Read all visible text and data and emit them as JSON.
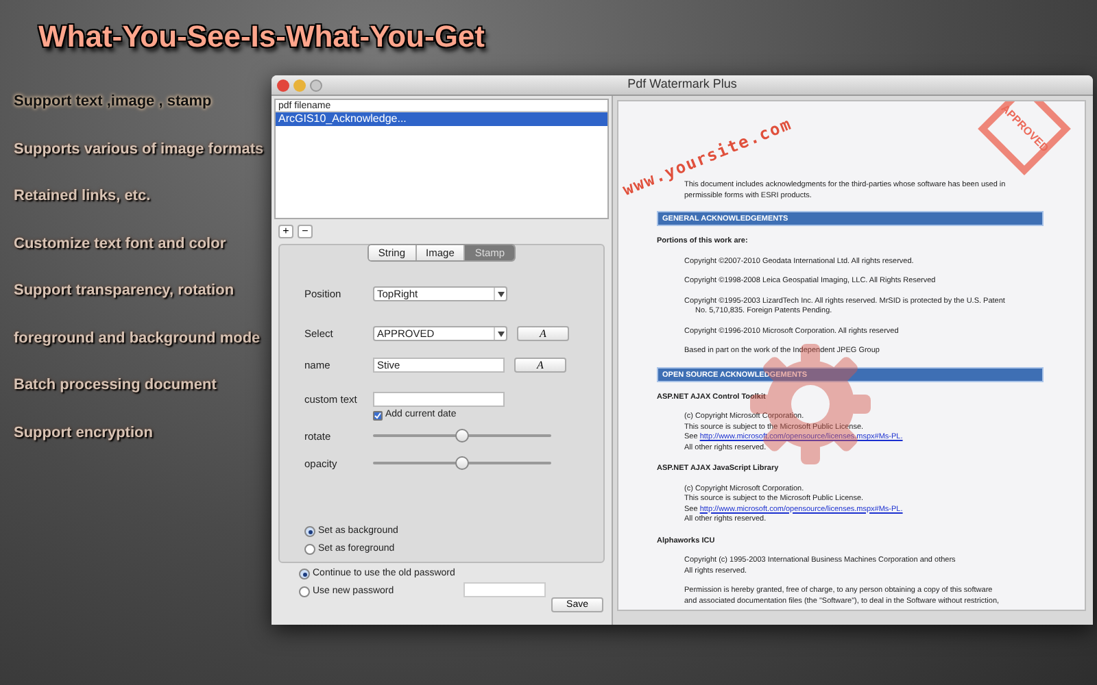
{
  "headline": "What-You-See-Is-What-You-Get",
  "features": [
    {
      "text": "Support text ,image , stamp",
      "selected": true
    },
    {
      "text": "Supports various of  image formats",
      "selected": false
    },
    {
      "text": "Retained links, etc.",
      "selected": false
    },
    {
      "text": "Customize text font and color",
      "selected": false
    },
    {
      "text": "Support transparency, rotation",
      "selected": false
    },
    {
      "text": "foreground and background mode",
      "selected": false
    },
    {
      "text": "Batch processing document",
      "selected": false
    },
    {
      "text": "Support encryption",
      "selected": false
    }
  ],
  "window": {
    "title": "Pdf Watermark Plus"
  },
  "file_list": {
    "column": "pdf filename",
    "rows": [
      {
        "name": "ArcGIS10_Acknowledge...",
        "selected": true
      }
    ]
  },
  "list_buttons": [
    "+",
    "−"
  ],
  "tabs": [
    {
      "label": "String",
      "selected": false
    },
    {
      "label": "Image",
      "selected": false
    },
    {
      "label": "Stamp",
      "selected": true
    }
  ],
  "form": {
    "position": {
      "label": "Position",
      "value": "TopRight"
    },
    "select": {
      "label": "Select",
      "value": "APPROVED",
      "button": "A"
    },
    "name": {
      "label": "name",
      "value": "Stive",
      "button": "A"
    },
    "custom_text": {
      "label": "custom text"
    },
    "add_date": {
      "label": "Add current date",
      "checked": true
    },
    "sliders": [
      {
        "label": "rotate",
        "level": 0.5
      },
      {
        "label": "opacity",
        "level": 0.5
      }
    ]
  },
  "layer_mode": [
    {
      "label": "Set as background",
      "selected": true
    },
    {
      "label": "Set as foreground",
      "selected": false
    }
  ],
  "password": [
    {
      "label": "Continue to use the old password",
      "selected": true
    },
    {
      "label": "Use new password",
      "selected": false
    }
  ],
  "save": "Save",
  "preview": {
    "watermark_text": "www.yoursite.com",
    "stamp_text": "APPROVED",
    "intro": "This document includes acknowledgments for the third-parties whose software has been used in permissible forms with ESRI products.",
    "blocks": [
      {
        "kind": "bar",
        "text": "GENERAL ACKNOWLEDGEMENTS"
      },
      {
        "kind": "bold",
        "text": "Portions of this work are:"
      },
      {
        "kind": "para",
        "lines": [
          {
            "text": "Copyright ©2007-2010 Geodata International Ltd. All rights reserved."
          }
        ]
      },
      {
        "kind": "para",
        "lines": [
          {
            "text": "Copyright ©1998-2008 Leica Geospatial Imaging, LLC. All Rights Reserved"
          }
        ]
      },
      {
        "kind": "para",
        "lines": [
          {
            "text": "Copyright ©1995-2003 LizardTech Inc.  All rights reserved.  MrSID is protected by the U.S. Patent"
          },
          {
            "text": "No. 5,710,835. Foreign Patents Pending."
          }
        ]
      },
      {
        "kind": "para",
        "lines": [
          {
            "text": "Copyright ©1996-2010 Microsoft Corporation. All rights reserved"
          }
        ]
      },
      {
        "kind": "para",
        "lines": [
          {
            "text": "Based in part on the work of the Independent JPEG Group"
          }
        ]
      },
      {
        "kind": "bar",
        "text": "OPEN SOURCE ACKNOWLEDGEMENTS"
      },
      {
        "kind": "bold",
        "text": "ASP.NET AJAX Control Toolkit"
      },
      {
        "kind": "para",
        "lines": [
          {
            "text": "(c) Copyright Microsoft Corporation."
          },
          {
            "text": "This source is subject to the Microsoft Public License."
          },
          {
            "text": "See ",
            "link": "http://www.microsoft.com/opensource/licenses.mspx#Ms-PL."
          },
          {
            "text": "All other rights reserved."
          }
        ]
      },
      {
        "kind": "bold",
        "text": "ASP.NET AJAX JavaScript Library"
      },
      {
        "kind": "para",
        "lines": [
          {
            "text": "(c) Copyright Microsoft Corporation."
          },
          {
            "text": "This source is subject to the Microsoft Public License."
          },
          {
            "text": "See ",
            "link": "http://www.microsoft.com/opensource/licenses.mspx#Ms-PL."
          },
          {
            "text": "All other rights reserved."
          }
        ]
      },
      {
        "kind": "bold",
        "text": "Alphaworks ICU"
      },
      {
        "kind": "para",
        "lines": [
          {
            "text": "Copyright (c) 1995-2003 International Business Machines Corporation and others"
          },
          {
            "text": "All rights reserved."
          }
        ]
      },
      {
        "kind": "para",
        "lines": [
          {
            "text": "Permission is hereby granted, free of charge, to any person obtaining a copy of this software"
          },
          {
            "text": "and associated documentation files (the \"Software\"), to deal in the Software without restriction,"
          }
        ]
      }
    ]
  }
}
